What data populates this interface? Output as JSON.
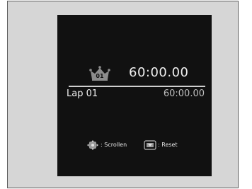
{
  "best_lap": {
    "icon": "crown-icon",
    "badge_number": "01",
    "time": "60:00.00"
  },
  "lap": {
    "label": "Lap 01",
    "time": "60:00.00"
  },
  "hints": {
    "scroll_icon": "four-way-scroll-icon",
    "scroll_text": ": Scrollen",
    "reset_icon": "reset-button-icon",
    "reset_text": ": Reset"
  },
  "colors": {
    "screen_bg": "#111111",
    "frame_bg": "#d6d6d6"
  }
}
